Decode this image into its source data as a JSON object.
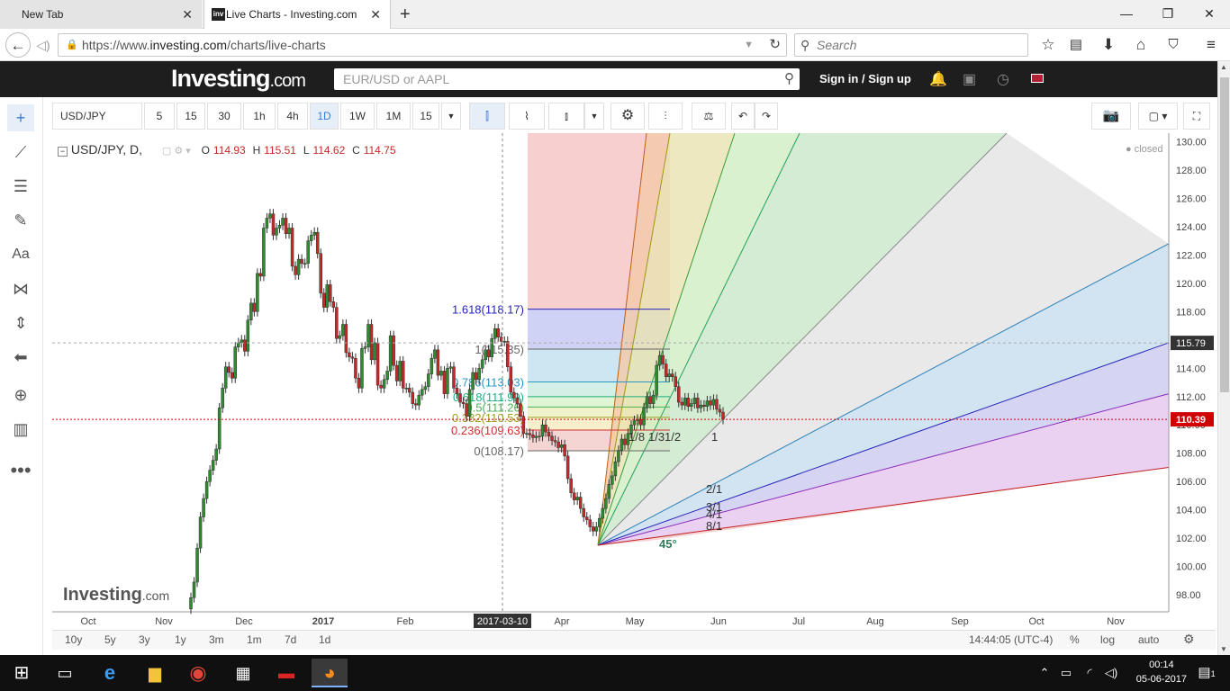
{
  "browser": {
    "tabs": [
      {
        "title": "New Tab"
      },
      {
        "title": "Live Charts - Investing.com",
        "favicon": "inv"
      }
    ],
    "url_prefix": "https://www.",
    "url_domain": "investing.com",
    "url_path": "/charts/live-charts",
    "search_placeholder": "Search"
  },
  "site": {
    "logo_main": "Investing",
    "logo_suffix": ".com",
    "search_placeholder": "EUR/USD or AAPL",
    "signin": "Sign in",
    "signup": "Sign up",
    "separator": "/"
  },
  "toolbar": {
    "symbol": "USD/JPY",
    "intervals": [
      "5",
      "15",
      "30",
      "1h",
      "4h",
      "1D",
      "1W",
      "1M",
      "15"
    ],
    "active_interval": "1D"
  },
  "legend": {
    "symbol": "USD/JPY, D,",
    "o_label": "O",
    "o": "114.93",
    "h_label": "H",
    "h": "115.51",
    "l_label": "L",
    "l": "114.62",
    "c_label": "C",
    "c": "114.75",
    "status": "closed"
  },
  "watermark": {
    "main": "Investing",
    "suffix": ".com"
  },
  "bottom": {
    "ranges": [
      "10y",
      "5y",
      "3y",
      "1y",
      "3m",
      "1m",
      "7d",
      "1d"
    ],
    "time": "14:44:05 (UTC-4)",
    "percent": "%",
    "log": "log",
    "auto": "auto"
  },
  "taskbar": {
    "time": "00:14",
    "date": "05-06-2017",
    "notif": "1"
  },
  "chart_data": {
    "type": "candlestick",
    "title": "USD/JPY, D,",
    "ylim": [
      96.8,
      130.6
    ],
    "y_ticks": [
      "98.00",
      "100.00",
      "102.00",
      "104.00",
      "106.00",
      "108.00",
      "110.00",
      "112.00",
      "114.00",
      "116.00",
      "118.00",
      "120.00",
      "122.00",
      "124.00",
      "126.00",
      "128.00",
      "130.00"
    ],
    "x_ticks": [
      "Oct",
      "Nov",
      "Dec",
      "2017",
      "Feb",
      "Apr",
      "May",
      "Jun",
      "Jul",
      "Aug",
      "Sep",
      "Oct",
      "Nov"
    ],
    "crosshair": {
      "x_label": "2017-03-10",
      "y_label": "115.79"
    },
    "last_price": "110.39",
    "closes": [
      97.8,
      98.9,
      101.3,
      103.5,
      104.8,
      106.0,
      106.8,
      107.5,
      108.3,
      111.2,
      112.6,
      114.1,
      113.7,
      113.3,
      115.5,
      115.8,
      116.0,
      115.2,
      117.4,
      118.6,
      118.0,
      120.7,
      120.5,
      123.9,
      124.6,
      124.9,
      123.4,
      123.9,
      124.1,
      124.6,
      123.5,
      123.9,
      121.2,
      120.6,
      121.7,
      121.4,
      121.4,
      123.0,
      123.4,
      123.6,
      122.1,
      119.3,
      118.3,
      119.9,
      118.7,
      118.3,
      116.1,
      116.3,
      117.1,
      115.1,
      114.8,
      114.7,
      113.3,
      112.6,
      115.4,
      115.5,
      117.1,
      114.6,
      115.8,
      112.8,
      112.6,
      113.2,
      113.8,
      116.3,
      114.2,
      113.1,
      114.5,
      112.6,
      112.6,
      112.3,
      111.5,
      111.4,
      112.1,
      112.5,
      112.7,
      113.6,
      114.7,
      115.3,
      113.5,
      113.8,
      112.2,
      114.0,
      114.1,
      112.6,
      112.2,
      111.6,
      111.5,
      110.6,
      112.5,
      113.7,
      113.2,
      114.0,
      114.6,
      115.3,
      114.8,
      116.1,
      116.8,
      116.2,
      115.9,
      115.9,
      114.1,
      112.3,
      111.9,
      111.5,
      110.6,
      109.4,
      109.4,
      109.3,
      109.1,
      109.2,
      109.2,
      110.0,
      109.5,
      109.2,
      108.9,
      108.8,
      108.4,
      108.6,
      107.8,
      106.2,
      105.2,
      104.7,
      104.9,
      104.1,
      103.5,
      103.3,
      102.8,
      102.5,
      102.8,
      103.4,
      104.1,
      104.8,
      105.8,
      106.4,
      107.4,
      108.2,
      109.0,
      108.6,
      109.4,
      110.0,
      110.3,
      110.4,
      110.0,
      111.2,
      112.0,
      111.5,
      112.1,
      114.2,
      114.9,
      114.3,
      113.4,
      113.6,
      113.4,
      112.7,
      111.6,
      111.4,
      111.9,
      111.3,
      111.5,
      111.9,
      111.2,
      111.4,
      111.3,
      111.7,
      111.4,
      111.8,
      111.1,
      110.9,
      110.4
    ],
    "fib": {
      "levels": [
        {
          "label": "1.618(118.17)",
          "value": 118.17,
          "color": "#2525b8"
        },
        {
          "label": "1(115.35)",
          "value": 115.35,
          "color": "#666666"
        },
        {
          "label": "0.786(113.03)",
          "value": 113.03,
          "color": "#2b95c4"
        },
        {
          "label": "0.618(111.99)",
          "value": 111.99,
          "color": "#1cae7a"
        },
        {
          "label": "0.5(111.26)",
          "value": 111.26,
          "color": "#4caf50"
        },
        {
          "label": "0.382(110.53)",
          "value": 110.53,
          "color": "#a0a020"
        },
        {
          "label": "0.236(109.63)",
          "value": 109.63,
          "color": "#d32f2f"
        },
        {
          "label": "0(108.17)",
          "value": 108.17,
          "color": "#666666"
        }
      ]
    },
    "gann_fan_labels": [
      "1/8",
      "1/3",
      "1/2",
      "1",
      "2/1",
      "3/1",
      "4/1",
      "8/1",
      "45°"
    ]
  }
}
